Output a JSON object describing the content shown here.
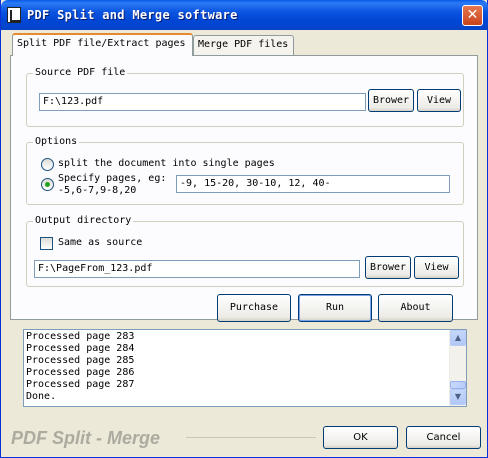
{
  "window": {
    "title": "PDF Split and Merge software",
    "close_glyph": "✕"
  },
  "tabs": [
    {
      "label": "Split PDF file/Extract pages",
      "active": true
    },
    {
      "label": "Merge PDF files",
      "active": false
    }
  ],
  "source": {
    "group_label": "Source PDF file",
    "path_value": "F:\\123.pdf",
    "browse_label": "Brower",
    "view_label": "View"
  },
  "options": {
    "group_label": "Options",
    "single_pages_label": "split the document into single pages",
    "specify_label_line1": "Specify pages,  eg:",
    "specify_label_line2": "-5,6-7,9-8,20",
    "pages_value": "-9, 15-20, 30-10, 12, 40-",
    "selected": "specify"
  },
  "output": {
    "group_label": "Output directory",
    "same_as_source_label": "Same as source",
    "same_as_source_checked": false,
    "path_value": "F:\\PageFrom_123.pdf",
    "browse_label": "Brower",
    "view_label": "View"
  },
  "actions": {
    "purchase_label": "Purchase",
    "run_label": "Run",
    "about_label": "About"
  },
  "log": {
    "lines": [
      "Processed page 283",
      "Processed page 284",
      "Processed page 285",
      "Processed page 286",
      "Processed page 287",
      "Done."
    ]
  },
  "footer": {
    "brand_text": "PDF Split - Merge",
    "ok_label": "OK",
    "cancel_label": "Cancel"
  },
  "colors": {
    "titlebar": "#0054e3",
    "dialog_bg": "#ece9d8",
    "panel_bg": "#fcfcfe",
    "tab_accent": "#e68b2c",
    "radio_dot": "#21a121"
  }
}
